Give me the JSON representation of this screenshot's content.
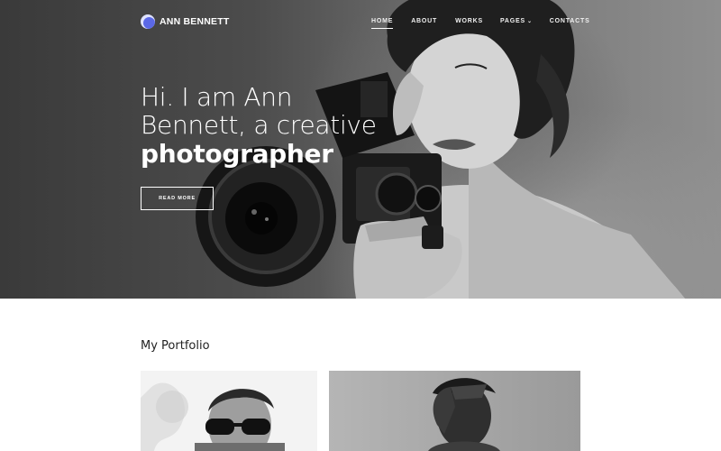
{
  "brand": {
    "name": "ANN BENNETT",
    "accent": "#5b68e6"
  },
  "nav": {
    "items": [
      {
        "label": "HOME",
        "active": true
      },
      {
        "label": "ABOUT",
        "active": false
      },
      {
        "label": "WORKS",
        "active": false
      },
      {
        "label": "PAGES",
        "active": false,
        "has_dropdown": true
      },
      {
        "label": "CONTACTS",
        "active": false
      }
    ],
    "dropdown_icon": "chevron-down-icon"
  },
  "hero": {
    "line1": "Hi. I am Ann",
    "line2": "Bennett, a creative",
    "line3": "photographer",
    "button_label": "READ MORE"
  },
  "portfolio": {
    "title": "My Portfolio"
  }
}
